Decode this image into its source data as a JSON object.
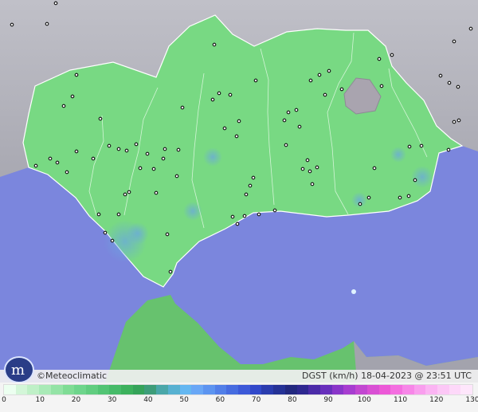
{
  "map": {
    "variable": "DGST (km/h)",
    "date": "18-04-2023 @ 23:51 UTC",
    "credit": "©Meteoclimatic",
    "colors": {
      "sea": "#7b86dd",
      "land_outside": "#ababb5",
      "andalusia": "#78d983",
      "morocco": "#67c26e",
      "borders": "#ffffff"
    },
    "stations_count_visible": "dense station coverage",
    "legend": {
      "ticks": [
        "0",
        "10",
        "20",
        "30",
        "40",
        "50",
        "60",
        "70",
        "80",
        "90",
        "100",
        "110",
        "120",
        "130"
      ],
      "colors": [
        "#ecfff0",
        "#d3f6d8",
        "#bff0c7",
        "#a9eab7",
        "#94e3a6",
        "#7fdc95",
        "#6ed58c",
        "#61cd80",
        "#52c474",
        "#46bb69",
        "#3cb15d",
        "#35a35a",
        "#3d9d79",
        "#4aa7a9",
        "#57b1d1",
        "#64b7f1",
        "#69a7f6",
        "#5c94f0",
        "#517fe8",
        "#466ce0",
        "#3c59d8",
        "#3149ca",
        "#2a3cae",
        "#253296",
        "#22287f",
        "#2e2890",
        "#4b2ba8",
        "#6830bc",
        "#8936c9",
        "#a73dd0",
        "#c247d1",
        "#d94fd4",
        "#ec58d7",
        "#f46ee0",
        "#f786e8",
        "#f99eee",
        "#fbb4f3",
        "#fcc7f6",
        "#fdd8f9",
        "#fee6fb"
      ]
    }
  }
}
